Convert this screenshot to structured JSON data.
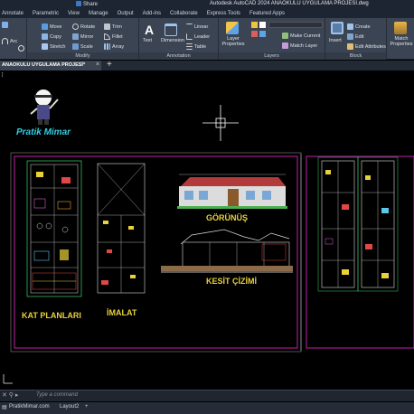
{
  "titlebar": {
    "share_label": "Share",
    "title": "Autodesk AutoCAD 2024   ANAOKULU UYGULAMA PROJESİ.dwg"
  },
  "ribbon_tabs": [
    "Annotate",
    "Parametric",
    "View",
    "Manage",
    "Output",
    "Add-ins",
    "Collaborate",
    "Express Tools",
    "Featured Apps"
  ],
  "ribbon": {
    "draw": {
      "line": "Line",
      "arc": "Arc"
    },
    "modify": {
      "title": "Modify",
      "move": "Move",
      "rotate": "Rotate",
      "trim": "Trim",
      "copy": "Copy",
      "mirror": "Mirror",
      "fillet": "Fillet",
      "stretch": "Stretch",
      "scale": "Scale",
      "array": "Array"
    },
    "annotation": {
      "title": "Annotation",
      "text": "Text",
      "dimension": "Dimension",
      "linear": "Linear",
      "leader": "Leader",
      "table": "Table"
    },
    "layers": {
      "title": "Layers",
      "layer_properties": "Layer Properties",
      "make_current": "Make Current",
      "match_layer": "Match Layer"
    },
    "block": {
      "title": "Block",
      "insert": "Insert",
      "create": "Create",
      "edit": "Edit",
      "edit_attributes": "Edit Attributes"
    },
    "properties": {
      "match": "Match Properties"
    }
  },
  "file_tab": {
    "label": "ANAOKULU UYGULAMA PROJESİ*"
  },
  "view_label": "]",
  "drawing": {
    "logo_text": "Pratik Mimar",
    "kat_planlari": "KAT PLANLARI",
    "imalat": "İMALAT",
    "gorunus": "GÖRÜNÜŞ",
    "kesit": "KESİT ÇİZİMİ"
  },
  "command": {
    "placeholder": "Type a command"
  },
  "layout_tabs": [
    "PratikMimar.com",
    "Layout2",
    "+"
  ],
  "colors": {
    "accent": "#3b79c8",
    "frame": "#c21fa6",
    "ribbon": "#3b4453",
    "title_bar": "#1d2532"
  }
}
